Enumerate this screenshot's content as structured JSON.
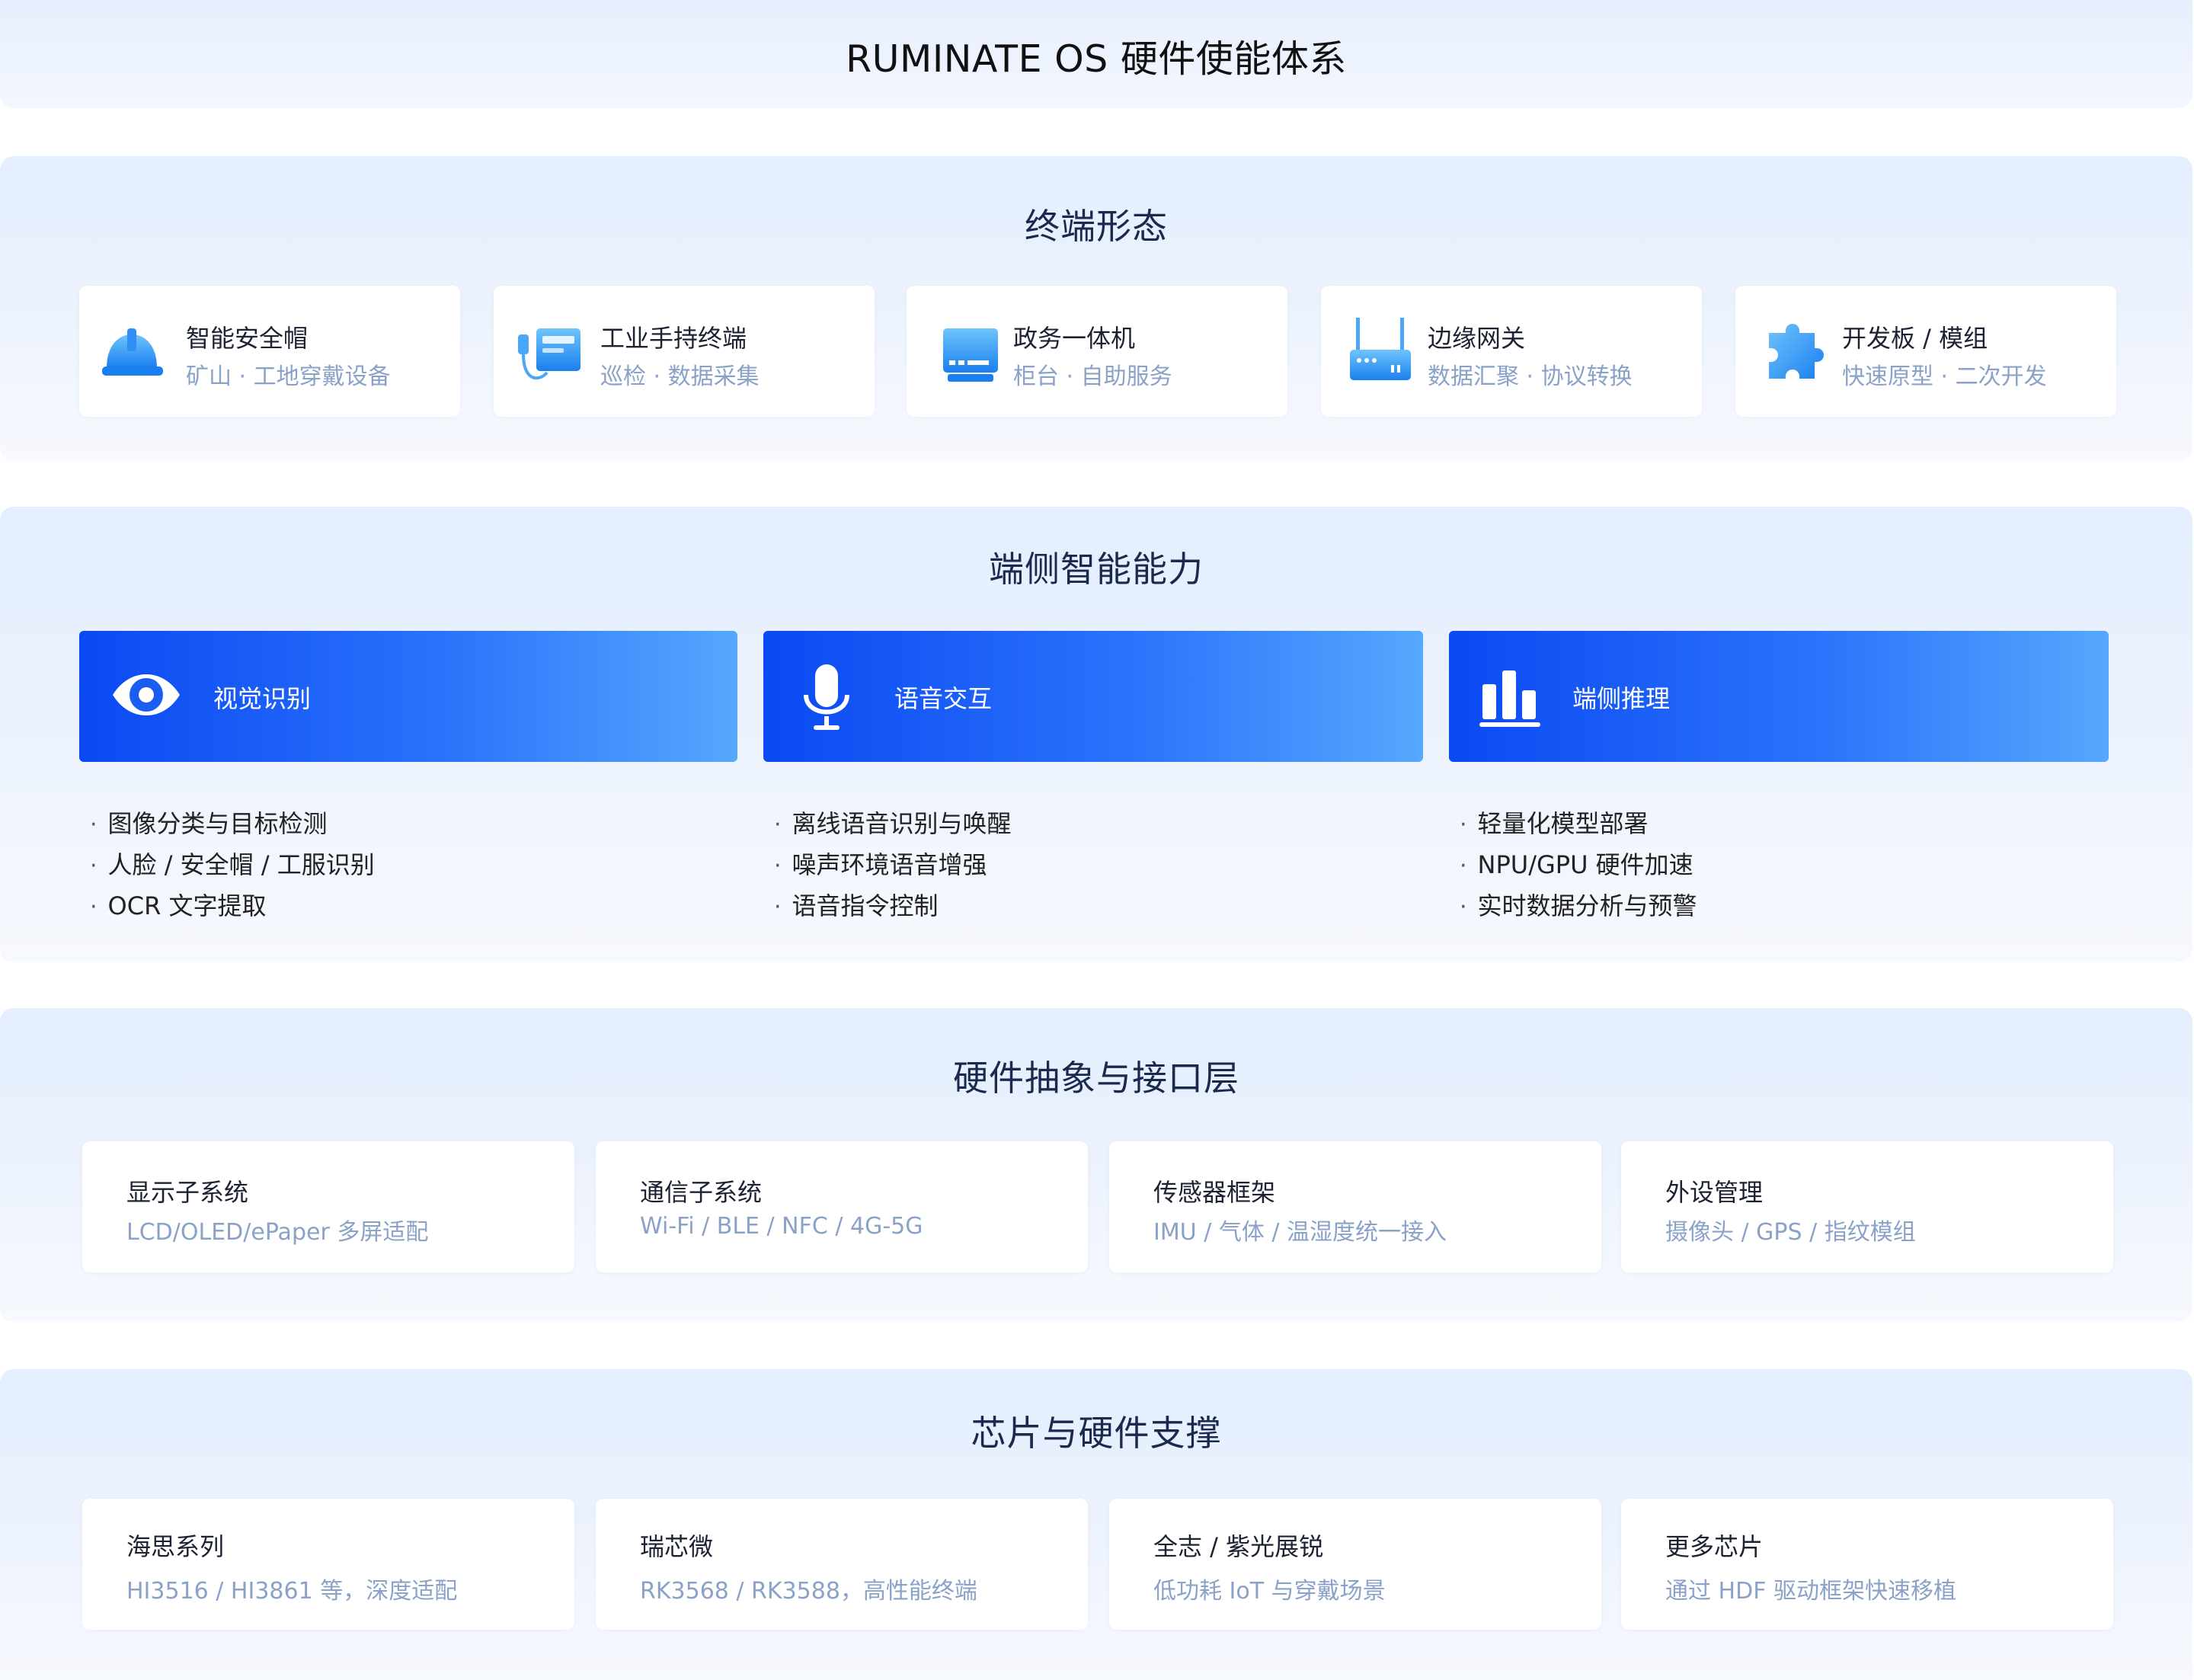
{
  "title": "RUMINATE OS 硬件使能体系",
  "terminals": {
    "title": "终端形态",
    "items": [
      {
        "title": "智能安全帽",
        "sub": "矿山 · 工地穿戴设备",
        "icon": "helmet-icon"
      },
      {
        "title": "工业手持终端",
        "sub": "巡检 · 数据采集",
        "icon": "handheld-terminal-icon"
      },
      {
        "title": "政务一体机",
        "sub": "柜台 · 自助服务",
        "icon": "kiosk-icon"
      },
      {
        "title": "边缘网关",
        "sub": "数据汇聚 · 协议转换",
        "icon": "router-icon"
      },
      {
        "title": "开发板 / 模组",
        "sub": "快速原型 · 二次开发",
        "icon": "puzzle-icon"
      }
    ]
  },
  "capabilities": {
    "title": "端侧智能能力",
    "items": [
      {
        "label": "视觉识别",
        "icon": "eye-icon",
        "bullets": [
          "图像分类与目标检测",
          "人脸 / 安全帽 / 工服识别",
          "OCR 文字提取"
        ]
      },
      {
        "label": "语音交互",
        "icon": "microphone-icon",
        "bullets": [
          "离线语音识别与唤醒",
          "噪声环境语音增强",
          "语音指令控制"
        ]
      },
      {
        "label": "端侧推理",
        "icon": "bar-chart-icon",
        "bullets": [
          "轻量化模型部署",
          "NPU/GPU 硬件加速",
          "实时数据分析与预警"
        ]
      }
    ]
  },
  "hal": {
    "title": "硬件抽象与接口层",
    "items": [
      {
        "title": "显示子系统",
        "sub": "LCD/OLED/ePaper 多屏适配"
      },
      {
        "title": "通信子系统",
        "sub": "Wi-Fi / BLE / NFC / 4G-5G"
      },
      {
        "title": "传感器框架",
        "sub": "IMU / 气体 / 温湿度统一接入"
      },
      {
        "title": "外设管理",
        "sub": "摄像头 / GPS / 指纹模组"
      }
    ]
  },
  "chips": {
    "title": "芯片与硬件支撑",
    "items": [
      {
        "title": "海思系列",
        "sub": "HI3516 / HI3861 等，深度适配"
      },
      {
        "title": "瑞芯微",
        "sub": "RK3568 / RK3588，高性能终端"
      },
      {
        "title": "全志 / 紫光展锐",
        "sub": "低功耗 IoT 与穿戴场景"
      },
      {
        "title": "更多芯片",
        "sub": "通过 HDF 驱动框架快速移植"
      }
    ]
  }
}
